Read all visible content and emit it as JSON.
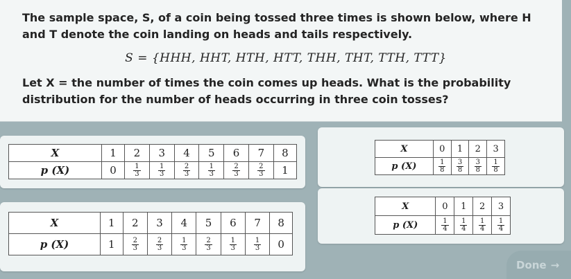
{
  "question": {
    "intro": "The sample space, S, of a coin being tossed three times is shown below, where H and T denote the coin landing on heads and tails respectively.",
    "sample_space": "S = {HHH, HHT, HTH, HTT, THH, THT, TTH, TTT}",
    "prompt": "Let X = the number of times the coin comes up heads. What is the probability distribution for the number of heads occurring in three coin tosses?"
  },
  "options": [
    {
      "id": "a",
      "x_header": "X",
      "p_header": "p (X)",
      "x_values": [
        "1",
        "2",
        "3",
        "4",
        "5",
        "6",
        "7",
        "8"
      ],
      "p_values": [
        "0",
        "1/3",
        "1/3",
        "2/3",
        "1/3",
        "2/3",
        "2/3",
        "1"
      ]
    },
    {
      "id": "b",
      "x_header": "X",
      "p_header": "p (X)",
      "x_values": [
        "0",
        "1",
        "2",
        "3"
      ],
      "p_values": [
        "1/8",
        "3/8",
        "3/8",
        "1/8"
      ]
    },
    {
      "id": "c",
      "x_header": "X",
      "p_header": "p (X)",
      "x_values": [
        "1",
        "2",
        "3",
        "4",
        "5",
        "6",
        "7",
        "8"
      ],
      "p_values": [
        "1",
        "2/3",
        "2/3",
        "1/3",
        "2/3",
        "1/3",
        "1/3",
        "0"
      ]
    },
    {
      "id": "d",
      "x_header": "X",
      "p_header": "p (X)",
      "x_values": [
        "0",
        "1",
        "2",
        "3"
      ],
      "p_values": [
        "1/4",
        "1/4",
        "1/4",
        "1/4"
      ]
    }
  ],
  "done": {
    "label": "Done",
    "arrow": "→"
  },
  "colors": {
    "background": "#9fb2b6",
    "card": "#f3f6f6",
    "done_text": "#c9d6d8"
  }
}
